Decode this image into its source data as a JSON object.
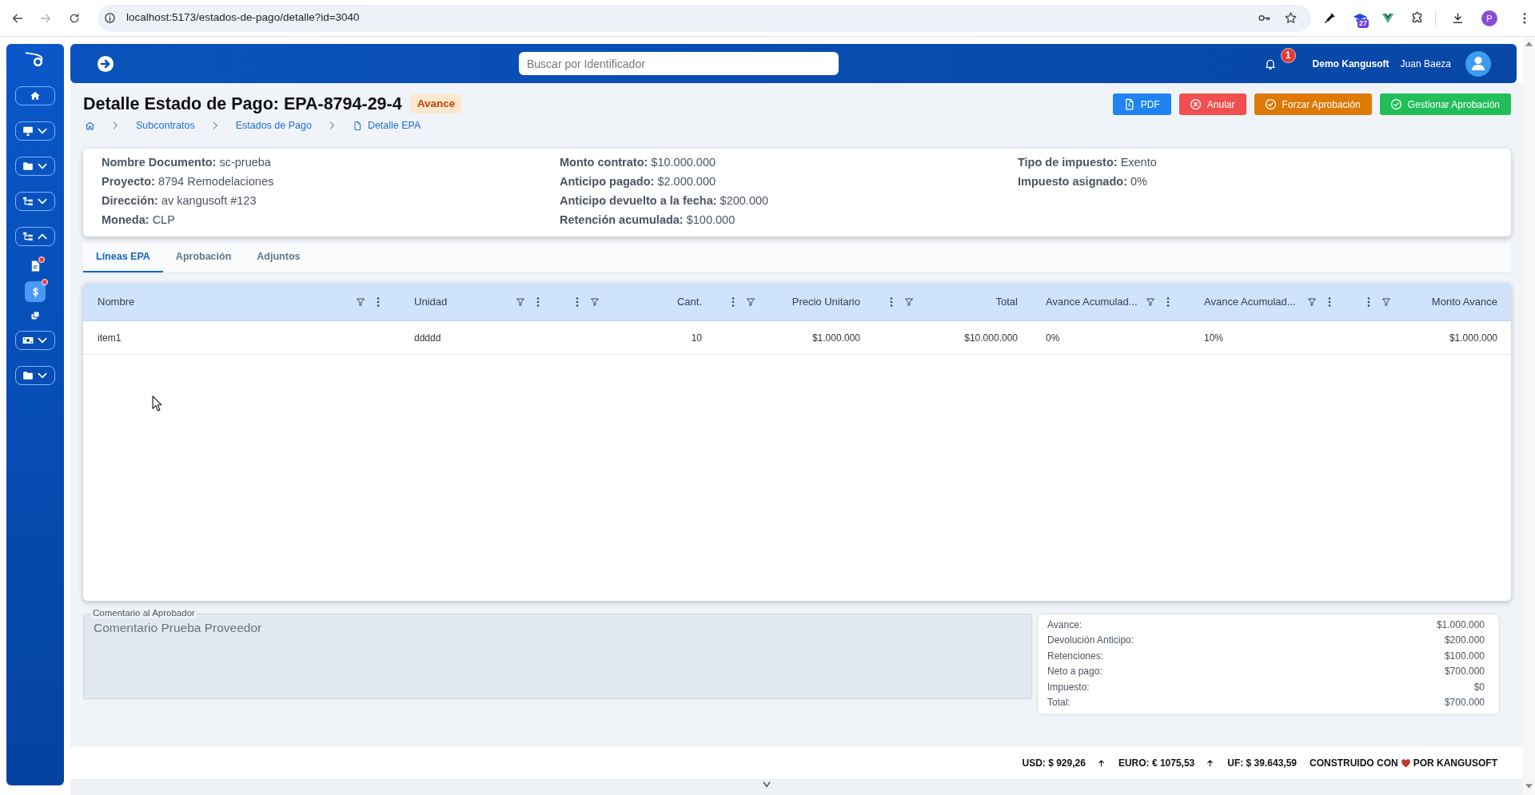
{
  "browser": {
    "url": "localhost:5173/estados-de-pago/detalle?id=3040",
    "extension_badge": "27",
    "profile_initial": "P"
  },
  "sidebar": {
    "items": [
      {
        "kind": "link",
        "selected": false
      },
      {
        "kind": "group",
        "selected": false,
        "expanded": false
      },
      {
        "kind": "group",
        "selected": false,
        "expanded": false
      },
      {
        "kind": "group",
        "selected": false,
        "expanded": false
      },
      {
        "kind": "group",
        "selected": false,
        "expanded": true,
        "children": [
          {
            "selected": false,
            "alert": true
          },
          {
            "selected": true,
            "alert": true
          },
          {
            "selected": false,
            "alert": false
          }
        ]
      },
      {
        "kind": "group",
        "selected": false,
        "expanded": false
      },
      {
        "kind": "group",
        "selected": false,
        "expanded": false
      }
    ]
  },
  "header": {
    "search": {
      "placeholder": "Buscar por Identificador"
    },
    "notifications": "1",
    "company": "Demo Kangusoft",
    "user": "Juan Baeza"
  },
  "page": {
    "title": "Detalle Estado de Pago: EPA-8794-29-4",
    "status": "Avance",
    "breadcrumb": [
      "Subcontratos",
      "Estados de Pago",
      "Detalle EPA"
    ],
    "actions": [
      {
        "label": "PDF",
        "kind": "pdf"
      },
      {
        "label": "Anular",
        "kind": "cancel"
      },
      {
        "label": "Forzar Aprobación",
        "kind": "force"
      },
      {
        "label": "Gestionar Aprobación",
        "kind": "approve"
      }
    ]
  },
  "details": {
    "columns": [
      [
        {
          "label": "Nombre Documento:",
          "value": "sc-prueba"
        },
        {
          "label": "Proyecto:",
          "value": "8794 Remodelaciones"
        },
        {
          "label": "Dirección:",
          "value": "av kangusoft #123"
        },
        {
          "label": "Moneda:",
          "value": "CLP"
        }
      ],
      [
        {
          "label": "Monto contrato:",
          "value": "$10.000.000"
        },
        {
          "label": "Anticipo pagado:",
          "value": "$2.000.000"
        },
        {
          "label": "Anticipo devuelto a la fecha:",
          "value": "$200.000"
        },
        {
          "label": "Retención acumulada:",
          "value": "$100.000"
        }
      ],
      [
        {
          "label": "Tipo de impuesto:",
          "value": "Exento"
        },
        {
          "label": "Impuesto asignado:",
          "value": "0%"
        }
      ]
    ]
  },
  "tabs": [
    {
      "label": "Líneas EPA",
      "selected": true
    },
    {
      "label": "Aprobación",
      "selected": false
    },
    {
      "label": "Adjuntos",
      "selected": false
    }
  ],
  "table": {
    "columns": [
      {
        "label": "Nombre",
        "kind": "text"
      },
      {
        "label": "Unidad",
        "kind": "text"
      },
      {
        "label": "Cant.",
        "kind": "number"
      },
      {
        "label": "Precio Unitario",
        "kind": "number"
      },
      {
        "label": "Total",
        "kind": "number"
      },
      {
        "label": "Avance Acumulad...",
        "kind": "text"
      },
      {
        "label": "Avance Acumulad...",
        "kind": "text"
      },
      {
        "label": "Monto Avance",
        "kind": "number"
      }
    ],
    "rows": [
      [
        "item1",
        "ddddd",
        "10",
        "$1.000.000",
        "$10.000.000",
        "0%",
        "10%",
        "$1.000.000"
      ]
    ]
  },
  "comment": {
    "label": "Comentario al Aprobador",
    "value": "Comentario Prueba Proveedor",
    "disabled": true
  },
  "summary": {
    "rows": [
      {
        "label": "Avance:",
        "value": "$1.000.000"
      },
      {
        "label": "Devolución Anticipo:",
        "value": "$200.000"
      },
      {
        "label": "Retenciones:",
        "value": "$100.000"
      },
      {
        "label": "Neto a pago:",
        "value": "$700.000"
      },
      {
        "label": "Impuesto:",
        "value": "$0"
      },
      {
        "label": "Total:",
        "value": "$700.000"
      }
    ]
  },
  "footer": {
    "rates": [
      {
        "text": "USD: $ 929,26",
        "rising": true
      },
      {
        "text": "EURO: € 1075,53",
        "rising": true
      },
      {
        "text": "UF: $ 39.643,59"
      }
    ],
    "credit_before": "CONSTRUIDO CON",
    "credit_after": "POR KANGUSOFT"
  }
}
